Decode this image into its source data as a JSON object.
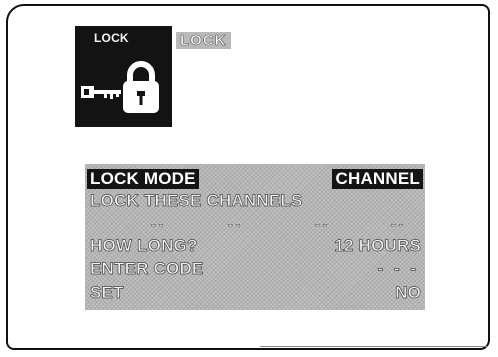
{
  "lock_icon": {
    "label": "LOCK",
    "icon_name": "lock-and-key-icon"
  },
  "header": {
    "title": "LOCK"
  },
  "menu": {
    "rows": [
      {
        "label": "LOCK MODE",
        "value": "CHANNEL",
        "highlighted": true
      },
      {
        "label": "LOCK THESE CHANNELS",
        "value": ""
      },
      {
        "label": "",
        "slots": [
          "--",
          "--",
          "--",
          "--"
        ]
      },
      {
        "label": "HOW LONG?",
        "value": "12 HOURS"
      },
      {
        "label": "ENTER CODE",
        "value": "- - -"
      },
      {
        "label": "SET",
        "value": "NO"
      }
    ]
  },
  "colors": {
    "menu_background": "#b6b6b6",
    "highlight_background": "#141414",
    "icon_tile_background": "#131313"
  }
}
